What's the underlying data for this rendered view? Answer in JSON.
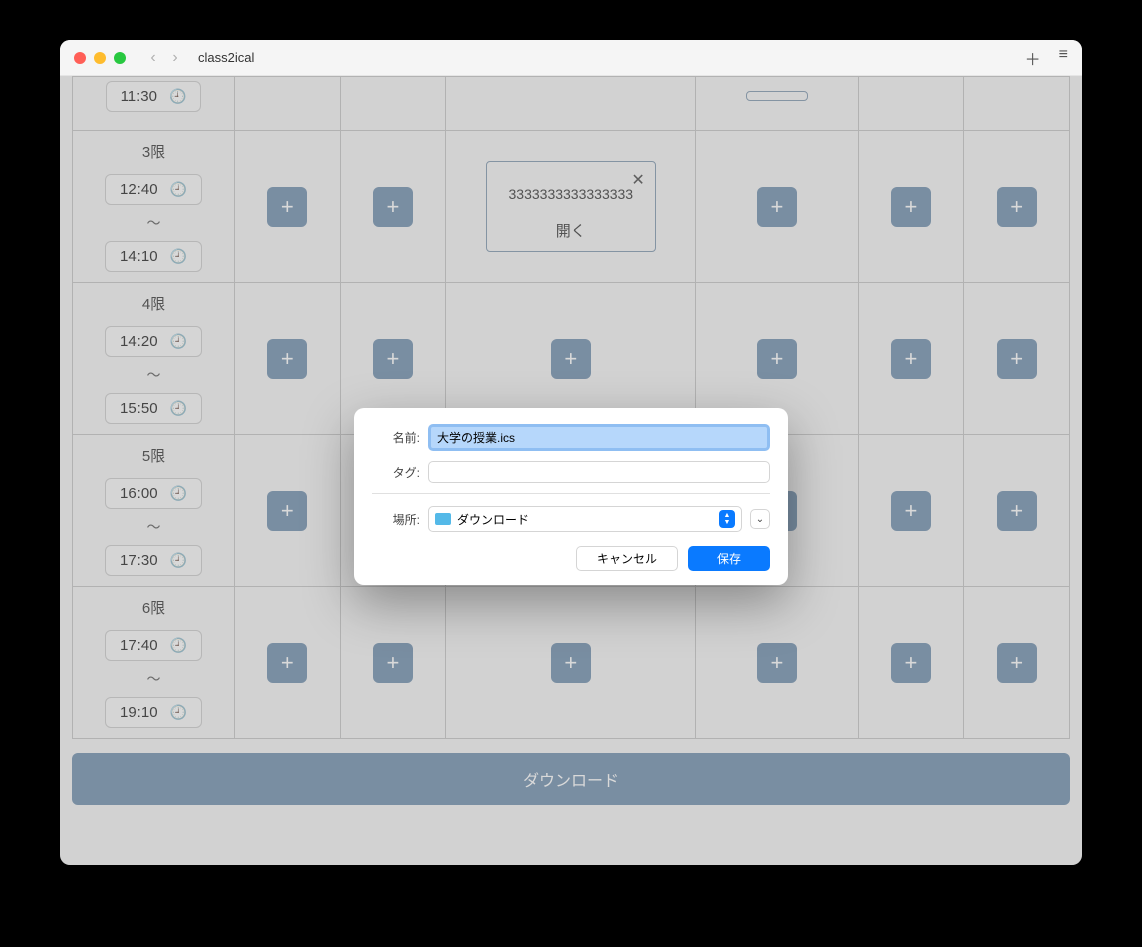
{
  "window": {
    "title": "class2ical"
  },
  "toolbar": {
    "plus": "＋",
    "menu": "≡"
  },
  "periods": [
    {
      "label": "",
      "start": "11:30",
      "end": "",
      "partial": true
    },
    {
      "label": "3限",
      "start": "12:40",
      "end": "14:10",
      "partial": false
    },
    {
      "label": "4限",
      "start": "14:20",
      "end": "15:50",
      "partial": false
    },
    {
      "label": "5限",
      "start": "16:00",
      "end": "17:30",
      "partial": false
    },
    {
      "label": "6限",
      "start": "17:40",
      "end": "19:10",
      "partial": false
    }
  ],
  "class_card": {
    "name": "3333333333333333",
    "open_label": "開く"
  },
  "download_button": "ダウンロード",
  "save_dialog": {
    "name_label": "名前:",
    "name_value": "大学の授業.ics",
    "tag_label": "タグ:",
    "tag_value": "",
    "location_label": "場所:",
    "location_value": "ダウンロード",
    "cancel": "キャンセル",
    "save": "保存"
  }
}
